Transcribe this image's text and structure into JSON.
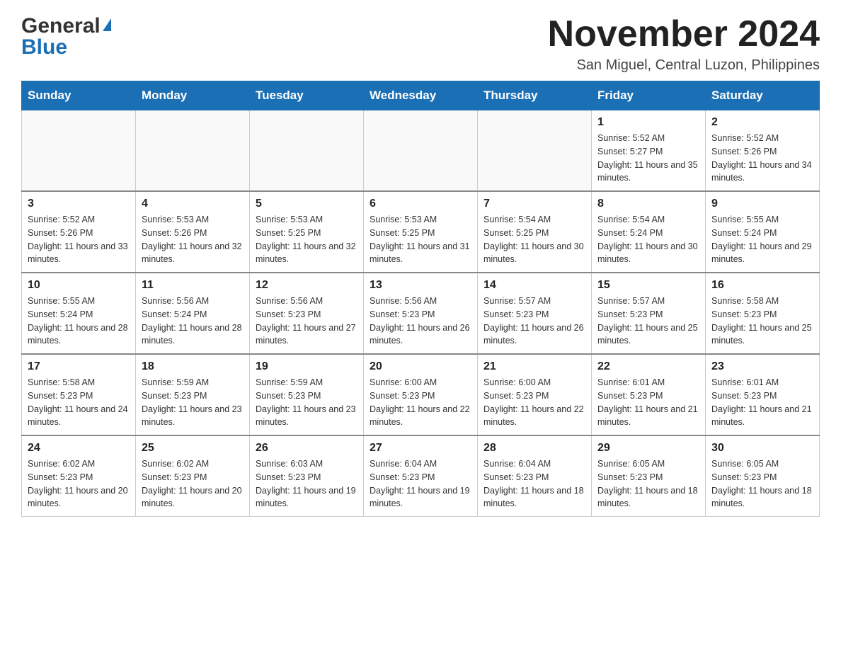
{
  "logo": {
    "general": "General",
    "blue": "Blue"
  },
  "header": {
    "month": "November 2024",
    "location": "San Miguel, Central Luzon, Philippines"
  },
  "days_of_week": [
    "Sunday",
    "Monday",
    "Tuesday",
    "Wednesday",
    "Thursday",
    "Friday",
    "Saturday"
  ],
  "weeks": [
    [
      {
        "day": "",
        "info": ""
      },
      {
        "day": "",
        "info": ""
      },
      {
        "day": "",
        "info": ""
      },
      {
        "day": "",
        "info": ""
      },
      {
        "day": "",
        "info": ""
      },
      {
        "day": "1",
        "info": "Sunrise: 5:52 AM\nSunset: 5:27 PM\nDaylight: 11 hours and 35 minutes."
      },
      {
        "day": "2",
        "info": "Sunrise: 5:52 AM\nSunset: 5:26 PM\nDaylight: 11 hours and 34 minutes."
      }
    ],
    [
      {
        "day": "3",
        "info": "Sunrise: 5:52 AM\nSunset: 5:26 PM\nDaylight: 11 hours and 33 minutes."
      },
      {
        "day": "4",
        "info": "Sunrise: 5:53 AM\nSunset: 5:26 PM\nDaylight: 11 hours and 32 minutes."
      },
      {
        "day": "5",
        "info": "Sunrise: 5:53 AM\nSunset: 5:25 PM\nDaylight: 11 hours and 32 minutes."
      },
      {
        "day": "6",
        "info": "Sunrise: 5:53 AM\nSunset: 5:25 PM\nDaylight: 11 hours and 31 minutes."
      },
      {
        "day": "7",
        "info": "Sunrise: 5:54 AM\nSunset: 5:25 PM\nDaylight: 11 hours and 30 minutes."
      },
      {
        "day": "8",
        "info": "Sunrise: 5:54 AM\nSunset: 5:24 PM\nDaylight: 11 hours and 30 minutes."
      },
      {
        "day": "9",
        "info": "Sunrise: 5:55 AM\nSunset: 5:24 PM\nDaylight: 11 hours and 29 minutes."
      }
    ],
    [
      {
        "day": "10",
        "info": "Sunrise: 5:55 AM\nSunset: 5:24 PM\nDaylight: 11 hours and 28 minutes."
      },
      {
        "day": "11",
        "info": "Sunrise: 5:56 AM\nSunset: 5:24 PM\nDaylight: 11 hours and 28 minutes."
      },
      {
        "day": "12",
        "info": "Sunrise: 5:56 AM\nSunset: 5:23 PM\nDaylight: 11 hours and 27 minutes."
      },
      {
        "day": "13",
        "info": "Sunrise: 5:56 AM\nSunset: 5:23 PM\nDaylight: 11 hours and 26 minutes."
      },
      {
        "day": "14",
        "info": "Sunrise: 5:57 AM\nSunset: 5:23 PM\nDaylight: 11 hours and 26 minutes."
      },
      {
        "day": "15",
        "info": "Sunrise: 5:57 AM\nSunset: 5:23 PM\nDaylight: 11 hours and 25 minutes."
      },
      {
        "day": "16",
        "info": "Sunrise: 5:58 AM\nSunset: 5:23 PM\nDaylight: 11 hours and 25 minutes."
      }
    ],
    [
      {
        "day": "17",
        "info": "Sunrise: 5:58 AM\nSunset: 5:23 PM\nDaylight: 11 hours and 24 minutes."
      },
      {
        "day": "18",
        "info": "Sunrise: 5:59 AM\nSunset: 5:23 PM\nDaylight: 11 hours and 23 minutes."
      },
      {
        "day": "19",
        "info": "Sunrise: 5:59 AM\nSunset: 5:23 PM\nDaylight: 11 hours and 23 minutes."
      },
      {
        "day": "20",
        "info": "Sunrise: 6:00 AM\nSunset: 5:23 PM\nDaylight: 11 hours and 22 minutes."
      },
      {
        "day": "21",
        "info": "Sunrise: 6:00 AM\nSunset: 5:23 PM\nDaylight: 11 hours and 22 minutes."
      },
      {
        "day": "22",
        "info": "Sunrise: 6:01 AM\nSunset: 5:23 PM\nDaylight: 11 hours and 21 minutes."
      },
      {
        "day": "23",
        "info": "Sunrise: 6:01 AM\nSunset: 5:23 PM\nDaylight: 11 hours and 21 minutes."
      }
    ],
    [
      {
        "day": "24",
        "info": "Sunrise: 6:02 AM\nSunset: 5:23 PM\nDaylight: 11 hours and 20 minutes."
      },
      {
        "day": "25",
        "info": "Sunrise: 6:02 AM\nSunset: 5:23 PM\nDaylight: 11 hours and 20 minutes."
      },
      {
        "day": "26",
        "info": "Sunrise: 6:03 AM\nSunset: 5:23 PM\nDaylight: 11 hours and 19 minutes."
      },
      {
        "day": "27",
        "info": "Sunrise: 6:04 AM\nSunset: 5:23 PM\nDaylight: 11 hours and 19 minutes."
      },
      {
        "day": "28",
        "info": "Sunrise: 6:04 AM\nSunset: 5:23 PM\nDaylight: 11 hours and 18 minutes."
      },
      {
        "day": "29",
        "info": "Sunrise: 6:05 AM\nSunset: 5:23 PM\nDaylight: 11 hours and 18 minutes."
      },
      {
        "day": "30",
        "info": "Sunrise: 6:05 AM\nSunset: 5:23 PM\nDaylight: 11 hours and 18 minutes."
      }
    ]
  ]
}
